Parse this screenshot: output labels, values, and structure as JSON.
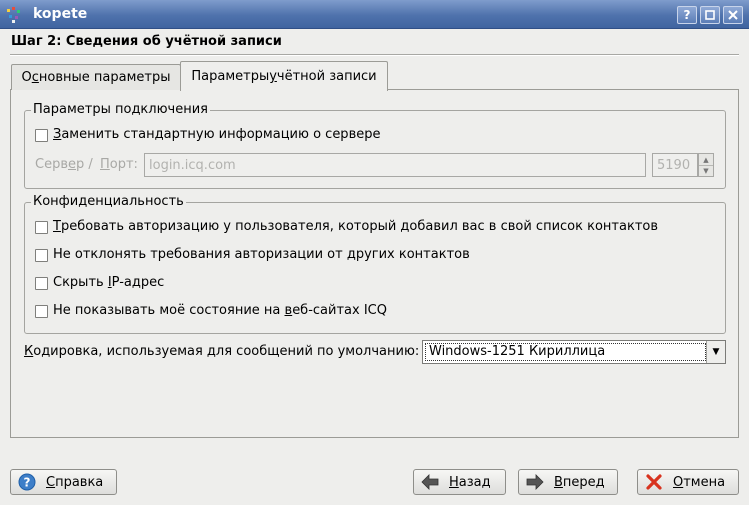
{
  "window": {
    "title": "kopete"
  },
  "header": {
    "step_title": "Шаг 2: Сведения об учётной записи"
  },
  "tabs": [
    {
      "pre": "О",
      "key": "с",
      "post": "новные параметры"
    },
    {
      "pre": "Параметры ",
      "key": "у",
      "post": "чётной записи"
    }
  ],
  "connection": {
    "group_title": "Параметры подключения",
    "override": {
      "pre": "",
      "key": "З",
      "post": "аменить стандартную информацию о сервере"
    },
    "server_label": {
      "pre": "Серв",
      "key": "е",
      "post": "р /"
    },
    "port_label": {
      "pre": "",
      "key": "П",
      "post": "орт:"
    },
    "server_value": "login.icq.com",
    "port_value": "5190"
  },
  "privacy": {
    "group_title": "Конфиденциальность",
    "items": [
      {
        "pre": "",
        "key": "Т",
        "post": "ребовать авторизацию у пользователя, который добавил вас в свой список контактов"
      },
      {
        "pre": "Не отклонять требования авторизации от ",
        "key": "д",
        "post": "ругих контактов"
      },
      {
        "pre": "Скрыть ",
        "key": "I",
        "post": "P-адрес"
      },
      {
        "pre": "Не показывать моё состояние на ",
        "key": "в",
        "post": "еб-сайтах ICQ"
      }
    ]
  },
  "encoding": {
    "label": {
      "pre": "",
      "key": "К",
      "post": "одировка, используемая для сообщений по умолчанию:"
    },
    "value": "Windows-1251 Кириллица"
  },
  "buttons": {
    "help": {
      "pre": "",
      "key": "С",
      "post": "правка"
    },
    "back": {
      "pre": "",
      "key": "Н",
      "post": "азад"
    },
    "next": {
      "pre": "",
      "key": "В",
      "post": "перед"
    },
    "cancel": {
      "pre": "",
      "key": "О",
      "post": "тмена"
    }
  },
  "colors": {
    "titlebar": "#4f72ac",
    "background": "#eeeeec",
    "cancel_icon": "#d8331f",
    "help_icon": "#3d7ec8"
  }
}
